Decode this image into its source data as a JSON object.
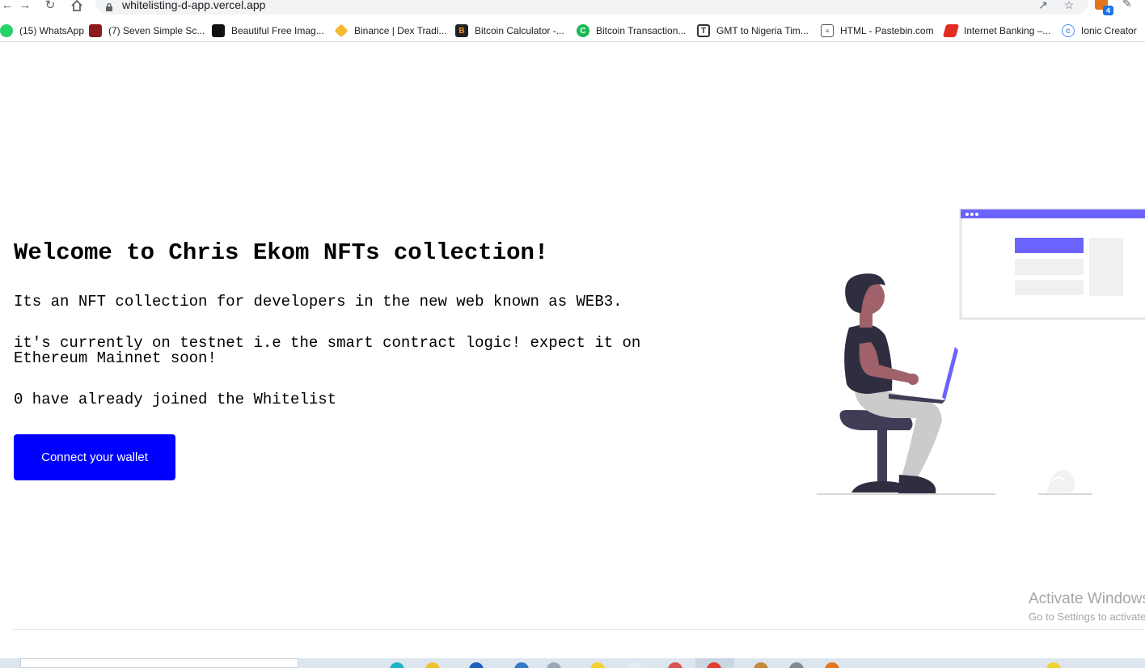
{
  "browser": {
    "url": "whitelisting-d-app.vercel.app",
    "extension_badge": "4",
    "bookmarks": [
      {
        "label": "(15) WhatsApp",
        "color": "#25d366"
      },
      {
        "label": "(7) Seven Simple Sc...",
        "color": "#8b1a1a"
      },
      {
        "label": "Beautiful Free Imag...",
        "color": "#111111"
      },
      {
        "label": "Binance | Dex Tradi...",
        "color": "#f3ba2f"
      },
      {
        "label": "Bitcoin Calculator -...",
        "color": "#222222"
      },
      {
        "label": "Bitcoin Transaction...",
        "color": "#18b956"
      },
      {
        "label": "GMT to Nigeria Tim...",
        "color": "#ffffff"
      },
      {
        "label": "HTML - Pastebin.com",
        "color": "#ffffff"
      },
      {
        "label": "Internet Banking –...",
        "color": "#e32b22"
      },
      {
        "label": "Ionic Creator",
        "color": "#4e8ef7"
      }
    ]
  },
  "hero": {
    "title": "Welcome to Chris Ekom NFTs collection!",
    "description": "Its an NFT collection for developers in the new web known as WEB3.",
    "testnet_note": "it's currently on testnet i.e the smart contract logic! expect it on Ethereum Mainnet soon!",
    "joined_count": 0,
    "joined_text": "0 have already joined the Whitelist",
    "connect_label": "Connect your wallet"
  },
  "illustration": {
    "accent_color": "#6c63ff",
    "skin_color": "#a0616a",
    "dark_color": "#2f2e41"
  },
  "windows_watermark": {
    "line1": "Activate Windows",
    "line2": "Go to Settings to activate Windows."
  },
  "colors": {
    "button_bg": "#0000ff",
    "button_text": "#ffffff"
  }
}
